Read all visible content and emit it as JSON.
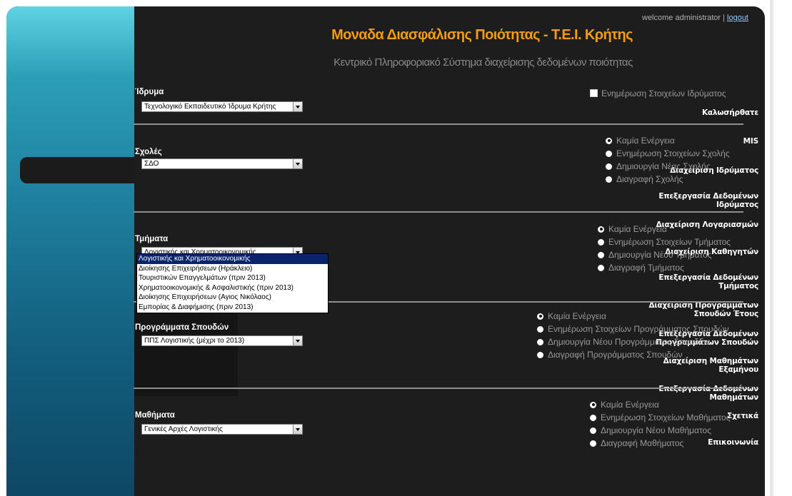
{
  "header": {
    "welcome_text": "welcome administrator |",
    "logout_label": "logout",
    "title": "Μοναδα Διασφάλισης Ποιότητας - Τ.Ε.Ι. Κρήτης",
    "subtitle": "Κεντρικό Πληροφοριακό Σύστημα διαχείρισης δεδομένων ποιότητας",
    "title_color": "#f39c12"
  },
  "sidebar": {
    "items": [
      {
        "label": "Καλωσήρθατε"
      },
      {
        "label": "MIS"
      },
      {
        "label": "Διαχείριση Ιδρύματος",
        "active": true
      },
      {
        "label": "Επεξεργασία Δεδομένων Ιδρύματος"
      },
      {
        "label": "Διαχείριση Λογαριασμών"
      },
      {
        "label": "Διαχείριση Καθηγητών"
      },
      {
        "label": "Επεξεργασία Δεδομένων Τμήματος"
      },
      {
        "label": "Διαχείριση Προγραμμάτων Σπουδών Έτους"
      },
      {
        "label": "Επεξεργασία Δεδομένων Προγραμμάτων Σπουδών"
      },
      {
        "label": "Διαχείριση Μαθημάτων Εξαμήνου"
      },
      {
        "label": "Επεξεργασία Δεδομένων Μαθημάτων"
      },
      {
        "label": "Σχετικά"
      },
      {
        "label": "Επικοινωνία"
      }
    ]
  },
  "institution": {
    "label": "Ίδρυμα",
    "selected": "Τεχνολογικό Εκπαιδευτικό Ίδρυμα Κρήτης",
    "checkbox_label": "Ενημέρωση Στοιχείων Ιδρύματος"
  },
  "schools": {
    "label": "Σχολές",
    "selected": "ΣΔΟ",
    "actions": [
      "Καμία Ενέργεια",
      "Ενημέρωση Στοιχείων Σχολής",
      "Δημιουργία Νέας Σχολής",
      "Διαγραφή Σχολής"
    ]
  },
  "departments": {
    "label": "Τμήματα",
    "selected": "Λογιστικής και Χρηματοοικονομικής",
    "options": [
      "Λογιστικής και Χρηματοοικονομικής",
      "Διοίκησης Επιχειρήσεων (Ηράκλειο)",
      "Τουριστικών Επαγγελμάτων (πριν 2013)",
      "Χρηματοοικονομικής & Ασφαλιστικής (πριν 2013)",
      "Διοίκησης Επιχειρήσεων (Αγιος Νικόλαος)",
      "Εμπορίας & Διαφήμισης (πριν 2013)"
    ],
    "actions": [
      "Καμία Ενέργεια",
      "Ενημέρωση Στοιχείων Τμήματος",
      "Δημιουργία Νέου Τμήματος",
      "Διαγραφή Τμήματος"
    ]
  },
  "programs": {
    "label": "Προγράμματα Σπουδών",
    "selected": "ΠΠΣ Λογιστικής (μέχρι το 2013)",
    "actions": [
      "Καμία Ενέργεια",
      "Ενημέρωση Στοιχείων Προγράμματος Σπουδών",
      "Δημιουργία Νέου Προγράμματος Σπουδών",
      "Διαγραφή Προγράμματος Σπουδών"
    ]
  },
  "courses": {
    "label": "Μαθήματα",
    "selected": "Γενικές Αρχές Λογιστικής",
    "actions": [
      "Καμία Ενέργεια",
      "Ενημέρωση Στοιχείων Μαθήματος",
      "Δημιουργία Νέου Μαθήματος",
      "Διαγραφή Μαθήματος"
    ]
  }
}
